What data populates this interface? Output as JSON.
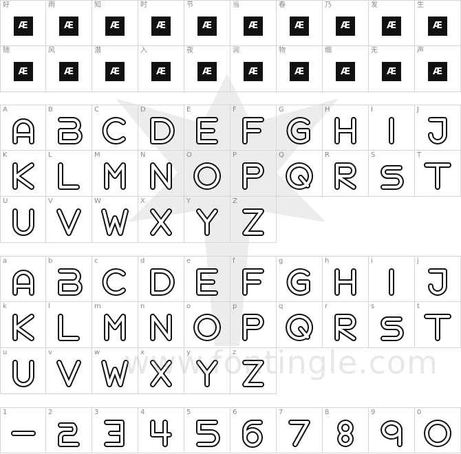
{
  "watermark": "www.fontingle.com",
  "cjk_rows": [
    [
      "好",
      "雨",
      "知",
      "时",
      "节",
      "当",
      "春",
      "乃",
      "发",
      "生"
    ],
    [
      "随",
      "风",
      "潜",
      "入",
      "夜",
      "润",
      "物",
      "细",
      "无",
      "声"
    ]
  ],
  "tofu_glyph": "Æ",
  "upper_rows": [
    [
      "A",
      "B",
      "C",
      "D",
      "E",
      "F",
      "G",
      "H",
      "I",
      "J"
    ],
    [
      "K",
      "L",
      "M",
      "N",
      "O",
      "P",
      "Q",
      "R",
      "S",
      "T"
    ],
    [
      "U",
      "V",
      "W",
      "X",
      "Y",
      "Z"
    ]
  ],
  "lower_rows": [
    [
      "a",
      "b",
      "c",
      "d",
      "e",
      "f",
      "g",
      "h",
      "i",
      "j"
    ],
    [
      "k",
      "l",
      "m",
      "n",
      "o",
      "p",
      "q",
      "r",
      "s",
      "t"
    ],
    [
      "u",
      "v",
      "w",
      "x",
      "y",
      "z"
    ]
  ],
  "digit_row": [
    "1",
    "2",
    "3",
    "4",
    "5",
    "6",
    "7",
    "8",
    "9",
    "0"
  ]
}
